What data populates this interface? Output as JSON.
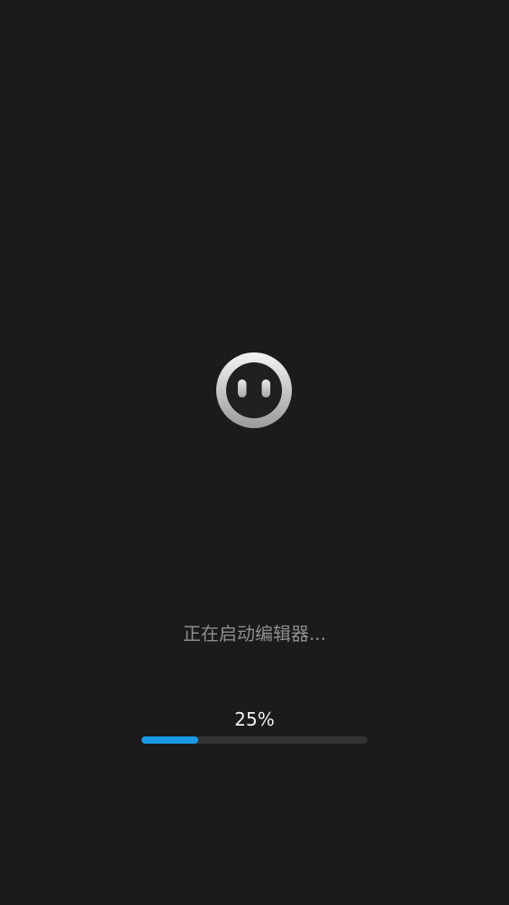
{
  "app": {
    "logo_icon": "face-logo-icon"
  },
  "loading": {
    "status_text": "正在启动编辑器...",
    "percent_text": "25%",
    "progress_fraction": 0.25
  },
  "colors": {
    "background": "#1b1b1b",
    "accent": "#1a9be8",
    "track": "#333333",
    "status_text": "#8e8e8e",
    "percent_text": "#f2f2f2"
  }
}
